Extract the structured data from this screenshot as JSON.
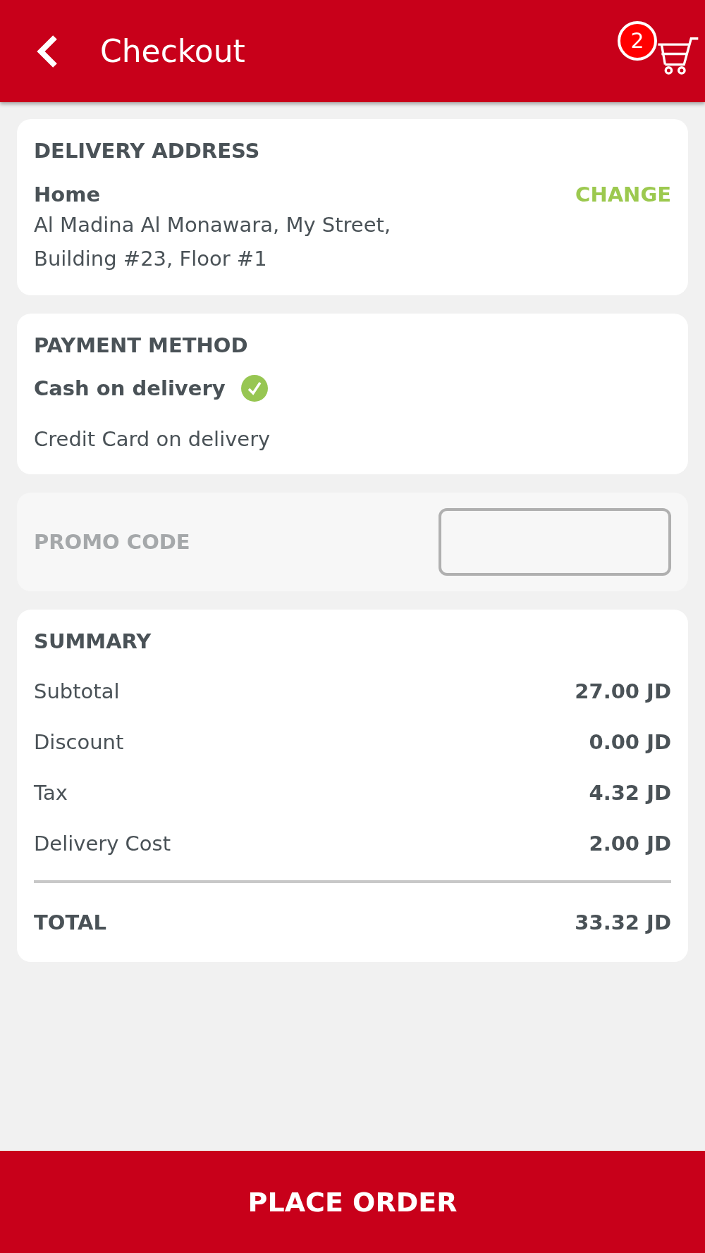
{
  "header": {
    "title": "Checkout",
    "cart_count": "2"
  },
  "delivery_address": {
    "heading": "DELIVERY ADDRESS",
    "name": "Home",
    "change_label": "CHANGE",
    "lines": [
      "Al Madina Al Monawara, My Street,",
      "Building #23, Floor #1"
    ]
  },
  "payment_method": {
    "heading": "PAYMENT METHOD",
    "options": [
      {
        "label": "Cash on delivery",
        "selected": true
      },
      {
        "label": "Credit Card on delivery",
        "selected": false
      }
    ]
  },
  "promo_code": {
    "label": "PROMO CODE"
  },
  "summary": {
    "heading": "SUMMARY",
    "rows": [
      {
        "label": "Subtotal",
        "value": "27.00 JD"
      },
      {
        "label": "Discount",
        "value": "0.00 JD"
      },
      {
        "label": "Tax",
        "value": "4.32 JD"
      },
      {
        "label": "Delivery Cost",
        "value": "2.00 JD"
      }
    ],
    "total": {
      "label": "TOTAL",
      "value": "33.32 JD"
    }
  },
  "place_order": "PLACE ORDER"
}
